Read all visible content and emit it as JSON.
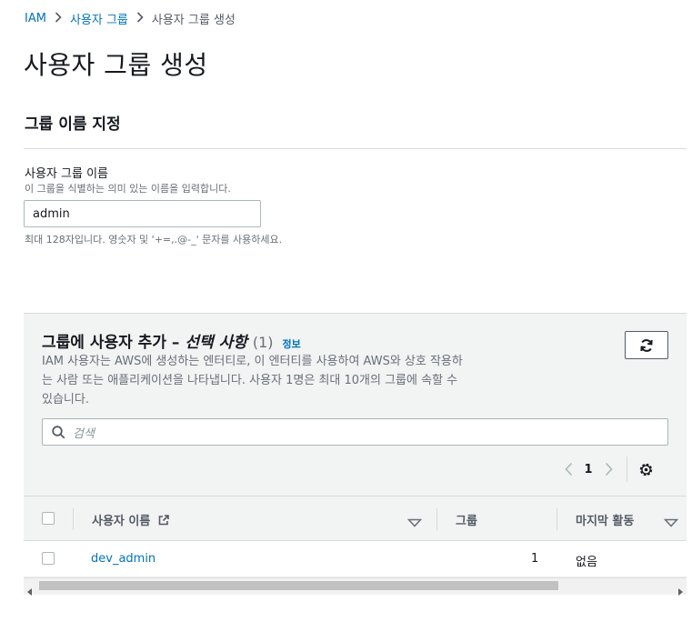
{
  "breadcrumb": {
    "items": [
      "IAM",
      "사용자 그룹"
    ],
    "current": "사용자 그룹 생성"
  },
  "page": {
    "title": "사용자 그룹 생성"
  },
  "name_section": {
    "title": "그룹 이름 지정",
    "label": "사용자 그룹 이름",
    "description": "이 그룹을 식별하는 의미 있는 이름을 입력합니다.",
    "value": "admin",
    "hint": "최대 128자입니다. 영숫자 및 '+=,.@-_' 문자를 사용하세요."
  },
  "users_panel": {
    "title": "그룹에 사용자 추가 –",
    "title_optional": "선택 사항",
    "count": "(1)",
    "info_link": "정보",
    "description": "IAM 사용자는 AWS에 생성하는 엔터티로, 이 엔터티를 사용하여 AWS와 상호 작용하는 사람 또는 애플리케이션을 나타냅니다. 사용자 1명은 최대 10개의 그룹에 속할 수 있습니다.",
    "search_placeholder": "검색",
    "page_number": "1",
    "columns": [
      "사용자 이름",
      "그룹",
      "마지막 활동"
    ],
    "rows": [
      {
        "name": "dev_admin",
        "groups": "1",
        "last_activity": "없음"
      }
    ]
  },
  "colors": {
    "link": "#0073bb",
    "panel_bg": "#f2f3f3",
    "text": "#16191f"
  }
}
